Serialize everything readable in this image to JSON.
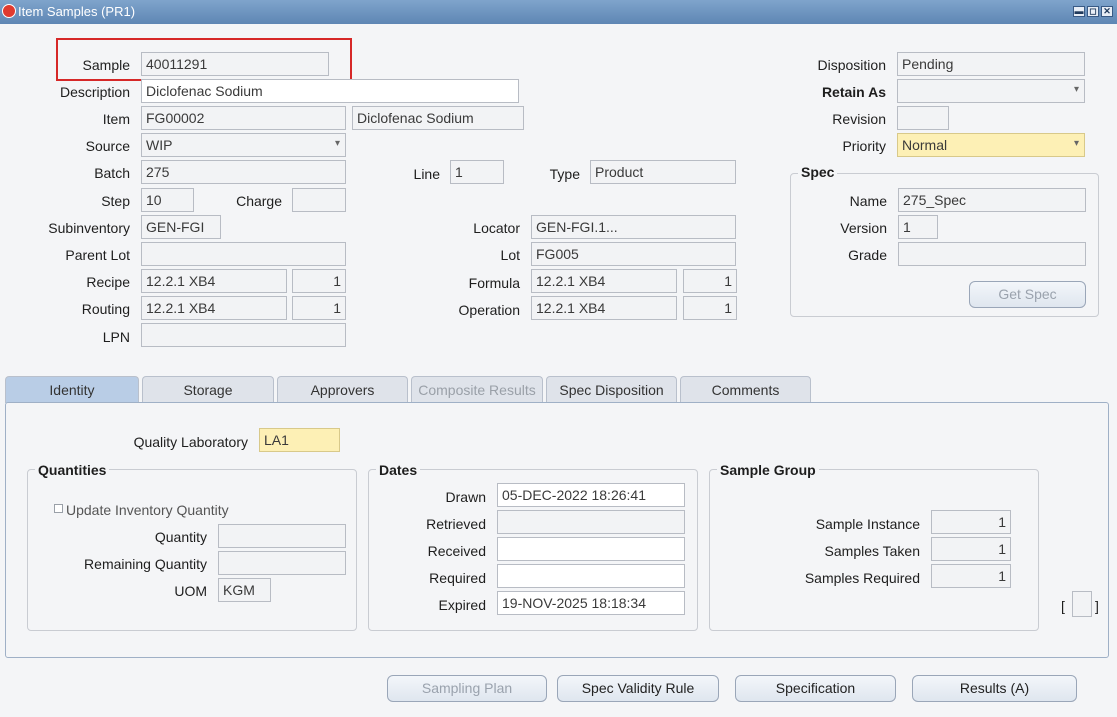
{
  "window": {
    "title": "Item Samples (PR1)",
    "min": "▬",
    "max": "◻",
    "close": "✕"
  },
  "header": {
    "sample_label": "Sample",
    "sample_value": "40011291",
    "description_label": "Description",
    "description_value": "Diclofenac Sodium",
    "item_label": "Item",
    "item_value": "FG00002",
    "item_desc": "Diclofenac Sodium",
    "source_label": "Source",
    "source_value": "WIP",
    "batch_label": "Batch",
    "batch_value": "275",
    "line_label": "Line",
    "line_value": "1",
    "type_label": "Type",
    "type_value": "Product",
    "step_label": "Step",
    "step_value": "10",
    "charge_label": "Charge",
    "charge_value": "",
    "subinventory_label": "Subinventory",
    "subinventory_value": "GEN-FGI",
    "locator_label": "Locator",
    "locator_value": "GEN-FGI.1...",
    "parent_lot_label": "Parent Lot",
    "parent_lot_value": "",
    "lot_label": "Lot",
    "lot_value": "FG005",
    "recipe_label": "Recipe",
    "recipe_value": "12.2.1 XB4",
    "recipe_ver": "1",
    "formula_label": "Formula",
    "formula_value": "12.2.1 XB4",
    "formula_ver": "1",
    "routing_label": "Routing",
    "routing_value": "12.2.1 XB4",
    "routing_ver": "1",
    "operation_label": "Operation",
    "operation_value": "12.2.1 XB4",
    "operation_ver": "1",
    "lpn_label": "LPN",
    "lpn_value": "",
    "disposition_label": "Disposition",
    "disposition_value": "Pending",
    "retain_as_label": "Retain As",
    "retain_as_value": "",
    "revision_label": "Revision",
    "revision_value": "",
    "priority_label": "Priority",
    "priority_value": "Normal"
  },
  "spec": {
    "title": "Spec",
    "name_label": "Name",
    "name_value": "275_Spec",
    "version_label": "Version",
    "version_value": "1",
    "grade_label": "Grade",
    "grade_value": "",
    "get_spec_button": "Get Spec"
  },
  "tabs": [
    "Identity",
    "Storage",
    "Approvers",
    "Composite Results",
    "Spec Disposition",
    "Comments"
  ],
  "identity": {
    "quality_lab_label": "Quality Laboratory",
    "quality_lab_value": "LA1",
    "quantities": {
      "title": "Quantities",
      "update_inventory_label": "Update Inventory Quantity",
      "quantity_label": "Quantity",
      "quantity_value": "",
      "remaining_label": "Remaining Quantity",
      "remaining_value": "",
      "uom_label": "UOM",
      "uom_value": "KGM"
    },
    "dates": {
      "title": "Dates",
      "drawn_label": "Drawn",
      "drawn_value": "05-DEC-2022 18:26:41",
      "retrieved_label": "Retrieved",
      "retrieved_value": "",
      "received_label": "Received",
      "received_value": "",
      "required_label": "Required",
      "required_value": "",
      "expired_label": "Expired",
      "expired_value": "19-NOV-2025 18:18:34"
    },
    "sample_group": {
      "title": "Sample Group",
      "instance_label": "Sample Instance",
      "instance_value": "1",
      "taken_label": "Samples Taken",
      "taken_value": "1",
      "required_label": "Samples Required",
      "required_value": "1"
    }
  },
  "buttons": {
    "sampling_plan": "Sampling Plan",
    "spec_validity_rule": "Spec Validity Rule",
    "specification": "Specification",
    "results": "Results (A)"
  }
}
